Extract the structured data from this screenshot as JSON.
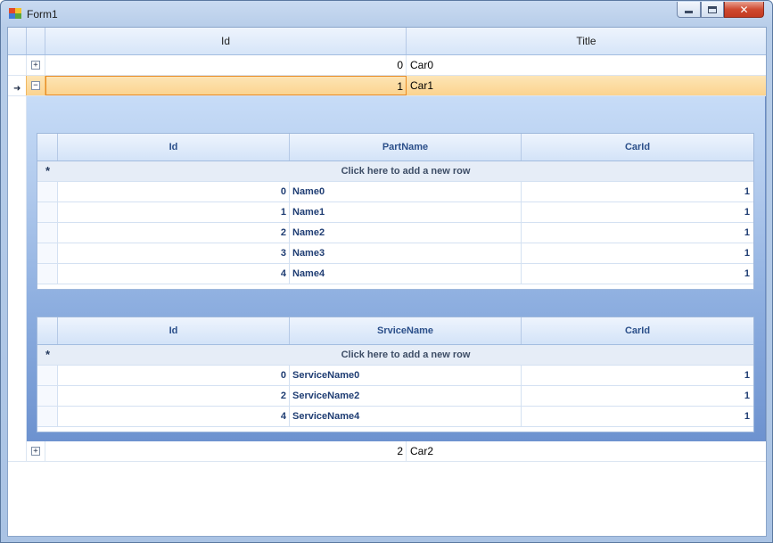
{
  "window": {
    "title": "Form1",
    "controls": {
      "minimize_icon": "minimize-icon",
      "maximize_icon": "maximize-icon",
      "close_glyph": "✕"
    }
  },
  "grid": {
    "columns": {
      "id": "Id",
      "title": "Title"
    },
    "rows": [
      {
        "id": "0",
        "title": "Car0",
        "expander": "⊞",
        "expanded": false
      },
      {
        "id": "1",
        "title": "Car1",
        "expander": "⊟",
        "expanded": true
      },
      {
        "id": "2",
        "title": "Car2",
        "expander": "⊞",
        "expanded": false
      }
    ],
    "current_row_marker": "➜"
  },
  "parts": {
    "columns": {
      "id": "Id",
      "name": "PartName",
      "carid": "CarId"
    },
    "new_row_marker": "*",
    "new_row_text": "Click here to add a new row",
    "rows": [
      {
        "id": "0",
        "name": "Name0",
        "carid": "1"
      },
      {
        "id": "1",
        "name": "Name1",
        "carid": "1"
      },
      {
        "id": "2",
        "name": "Name2",
        "carid": "1"
      },
      {
        "id": "3",
        "name": "Name3",
        "carid": "1"
      },
      {
        "id": "4",
        "name": "Name4",
        "carid": "1"
      }
    ]
  },
  "services": {
    "columns": {
      "id": "Id",
      "name": "SrviceName",
      "carid": "CarId"
    },
    "new_row_marker": "*",
    "new_row_text": "Click here to add a new row",
    "rows": [
      {
        "id": "0",
        "name": "ServiceName0",
        "carid": "1"
      },
      {
        "id": "2",
        "name": "ServiceName2",
        "carid": "1"
      },
      {
        "id": "4",
        "name": "ServiceName4",
        "carid": "1"
      }
    ]
  },
  "colors": {
    "selected_row": "#fbd38e",
    "selected_border": "#e88b24",
    "detail_gradient_top": "#c7dcf7",
    "detail_gradient_bottom": "#6d92cf",
    "close_button": "#cf4a30"
  }
}
